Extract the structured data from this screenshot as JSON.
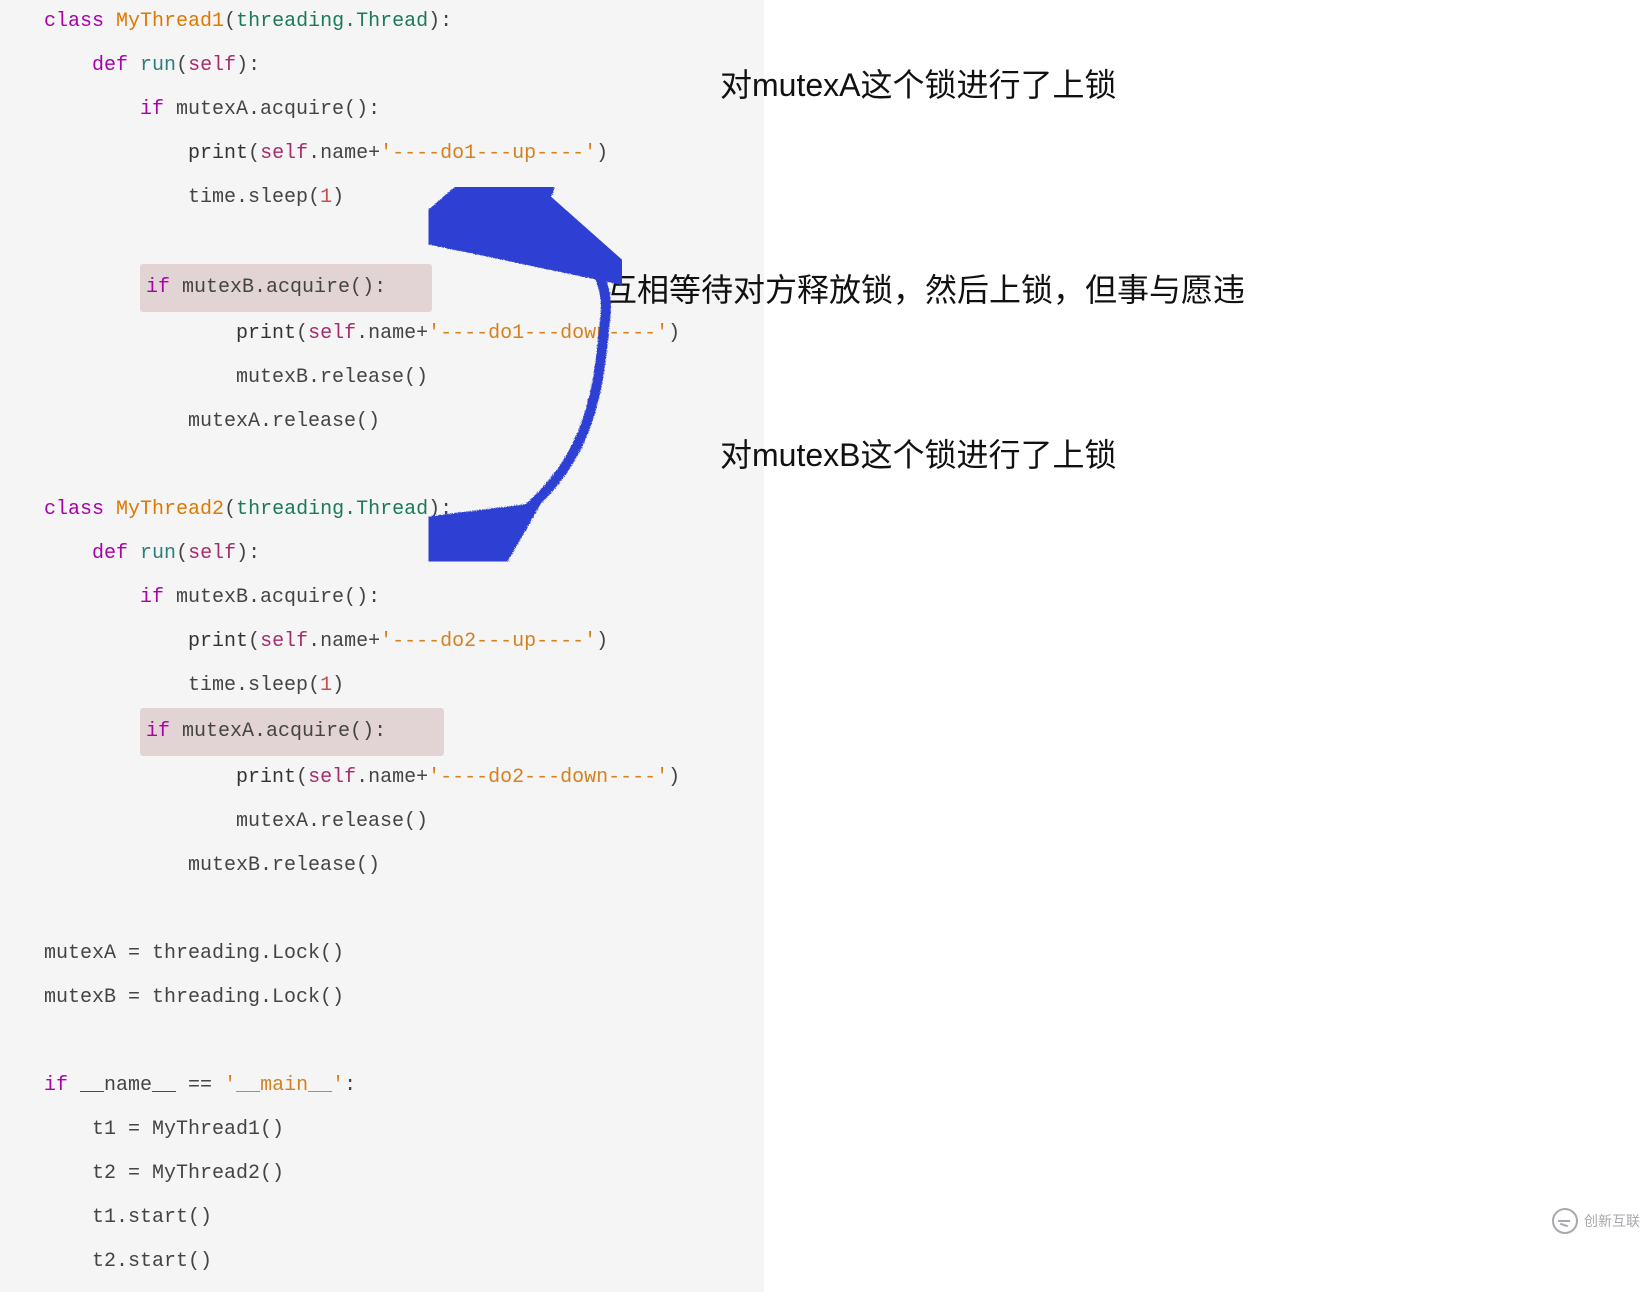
{
  "code": {
    "l1": {
      "kw": "class",
      "name": "MyThread1",
      "paren_open": "(",
      "type": "threading.Thread",
      "paren_close": ")",
      "colon": ":"
    },
    "l2": {
      "kw": "def",
      "name": "run",
      "paren": "(",
      "self": "self",
      "close": "):"
    },
    "l3": {
      "kw": "if",
      "expr": " mutexA.acquire():"
    },
    "l4": {
      "print": "print",
      "open": "(",
      "self": "self",
      "rest": ".name+",
      "str": "'----do1---up----'",
      "close": ")"
    },
    "l5": {
      "call": "time.sleep",
      "open": "(",
      "num": "1",
      "close": ")"
    },
    "l6": {
      "kw": "if",
      "expr": " mutexB.acquire():"
    },
    "l7": {
      "print": "print",
      "open": "(",
      "self": "self",
      "rest": ".name+",
      "str": "'----do1---down----'",
      "close": ")"
    },
    "l8": {
      "call": "mutexB.release()"
    },
    "l9": {
      "call": "mutexA.release()"
    },
    "l10": {
      "kw": "class",
      "name": "MyThread2",
      "paren_open": "(",
      "type": "threading.Thread",
      "paren_close": ")",
      "colon": ":"
    },
    "l11": {
      "kw": "def",
      "name": "run",
      "paren": "(",
      "self": "self",
      "close": "):"
    },
    "l12": {
      "kw": "if",
      "expr": " mutexB.acquire():"
    },
    "l13": {
      "print": "print",
      "open": "(",
      "self": "self",
      "rest": ".name+",
      "str": "'----do2---up----'",
      "close": ")"
    },
    "l14": {
      "call": "time.sleep",
      "open": "(",
      "num": "1",
      "close": ")"
    },
    "l15": {
      "kw": "if",
      "expr": " mutexA.acquire():"
    },
    "l16": {
      "print": "print",
      "open": "(",
      "self": "self",
      "rest": ".name+",
      "str": "'----do2---down----'",
      "close": ")"
    },
    "l17": {
      "call": "mutexA.release()"
    },
    "l18": {
      "call": "mutexB.release()"
    },
    "l19": {
      "txt": "mutexA = threading.Lock()"
    },
    "l20": {
      "txt": "mutexB = threading.Lock()"
    },
    "l21": {
      "kw": "if",
      "name": " __name__ ",
      "eq": "== ",
      "str": "'__main__'",
      "colon": ":"
    },
    "l22": {
      "txt": "t1 = MyThread1()"
    },
    "l23": {
      "txt": "t2 = MyThread2()"
    },
    "l24": {
      "txt": "t1.start()"
    },
    "l25": {
      "txt": "t2.start()"
    }
  },
  "annotations": {
    "a1": "对mutexA这个锁进行了上锁",
    "a2": "互相等待对方释放锁，然后上锁，但事与愿违",
    "a3": "对mutexB这个锁进行了上锁"
  },
  "watermark": "创新互联"
}
